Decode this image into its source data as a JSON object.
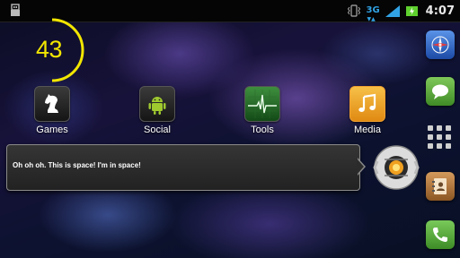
{
  "status_bar": {
    "usb_icon": "usb-icon",
    "vibrate_icon": "vibrate-icon",
    "network_type": "3G",
    "signal_icon": "signal-bars-icon",
    "battery_icon": "battery-charging-icon",
    "time": "4:07"
  },
  "clock_widget": {
    "value": "43",
    "color": "#f2e600"
  },
  "folders": [
    {
      "label": "Games",
      "icon": "chess-knight-icon"
    },
    {
      "label": "Social",
      "icon": "android-robot-icon"
    },
    {
      "label": "Tools",
      "icon": "heartbeat-monitor-icon"
    },
    {
      "label": "Media",
      "icon": "music-note-icon"
    }
  ],
  "toast": {
    "message": "Oh oh oh. This is space! I'm in space!"
  },
  "portal_core_icon": "portal-core-icon",
  "dock": {
    "items": [
      {
        "icon": "compass-icon",
        "color": "#2a66c8"
      },
      {
        "icon": "chat-bubble-icon",
        "color": "#5ca33c"
      },
      {
        "icon": "app-drawer-grid-icon"
      },
      {
        "icon": "contacts-book-icon",
        "color": "#b0743b"
      },
      {
        "icon": "phone-icon",
        "color": "#54a53c"
      }
    ]
  }
}
